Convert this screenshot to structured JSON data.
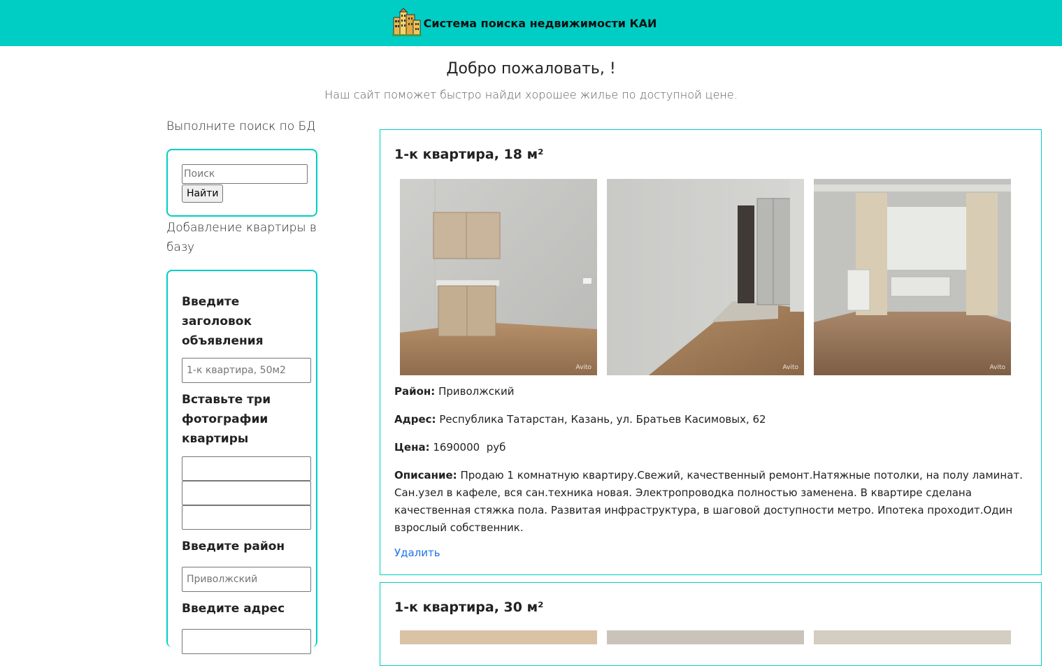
{
  "header": {
    "title": "Система поиска недвижимости КАИ",
    "logo_icon": "city-buildings-icon",
    "bg_color": "#00cec4"
  },
  "welcome": {
    "title": "Добро пожаловать, !",
    "subtitle": "Наш сайт поможет быстро найди хорошее жилье по доступной цене."
  },
  "search": {
    "caption": "Выполните поиск по БД",
    "placeholder": "Поиск",
    "button_label": "Найти"
  },
  "add_form": {
    "caption": "Добавление квартиры в базу",
    "title_label": "Введите заголовок объявления",
    "title_placeholder": "1-к квартира, 50м2",
    "photos_label": "Вставьте три фотографии квартиры",
    "district_label": "Введите район",
    "district_placeholder": "Приволжский",
    "address_label": "Введите адрес"
  },
  "listings": [
    {
      "title": "1-к квартира, 18 м²",
      "district_label": "Район:",
      "district": "Приволжский",
      "address_label": "Адрес:",
      "address": "Республика Татарстан, Казань, ул. Братьев Касимовых, 62",
      "price_label": "Цена:",
      "price": "1690000  руб",
      "description_label": "Описание:",
      "description": "Продаю 1 комнатную квартиру.Свежий, качественный ремонт.Натяжные потолки, на полу ламинат. Сан.узел в кафеле, вся сан.техника новая. Электропроводка полностью заменена. В квартире сделана качественная стяжка пола. Развитая инфраструктура, в шаговой доступности метро. Ипотека проходит.Один взрослый собственник.",
      "delete_label": "Удалить",
      "photo_watermark": "Avito"
    },
    {
      "title": "1-к квартира, 30 м²"
    }
  ],
  "colors": {
    "accent": "#00cec4",
    "link": "#1a73e8"
  }
}
